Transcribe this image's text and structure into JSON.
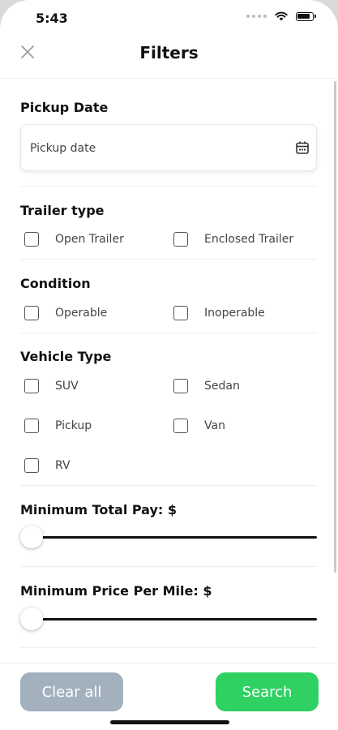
{
  "status_bar": {
    "time": "5:43"
  },
  "header": {
    "title": "Filters",
    "close_icon": "close-icon"
  },
  "pickup_date": {
    "title": "Pickup Date",
    "placeholder": "Pickup date",
    "icon": "calendar-icon"
  },
  "trailer_type": {
    "title": "Trailer type",
    "options": [
      {
        "label": "Open Trailer",
        "checked": false
      },
      {
        "label": "Enclosed Trailer",
        "checked": false
      }
    ]
  },
  "condition": {
    "title": "Condition",
    "options": [
      {
        "label": "Operable",
        "checked": false
      },
      {
        "label": "Inoperable",
        "checked": false
      }
    ]
  },
  "vehicle_type": {
    "title": "Vehicle Type",
    "options": [
      {
        "label": "SUV",
        "checked": false
      },
      {
        "label": "Sedan",
        "checked": false
      },
      {
        "label": "Pickup",
        "checked": false
      },
      {
        "label": "Van",
        "checked": false
      },
      {
        "label": "RV",
        "checked": false
      }
    ]
  },
  "min_total_pay": {
    "title": "Minimum Total Pay:  $",
    "value_fraction": 0
  },
  "min_price_per_mile": {
    "title": "Minimum Price Per Mile: $",
    "value_fraction": 0
  },
  "footer": {
    "clear_label": "Clear all",
    "search_label": "Search"
  },
  "colors": {
    "search_button": "#2ed162",
    "clear_button": "#a3b1bf",
    "slider_track": "#111111"
  }
}
